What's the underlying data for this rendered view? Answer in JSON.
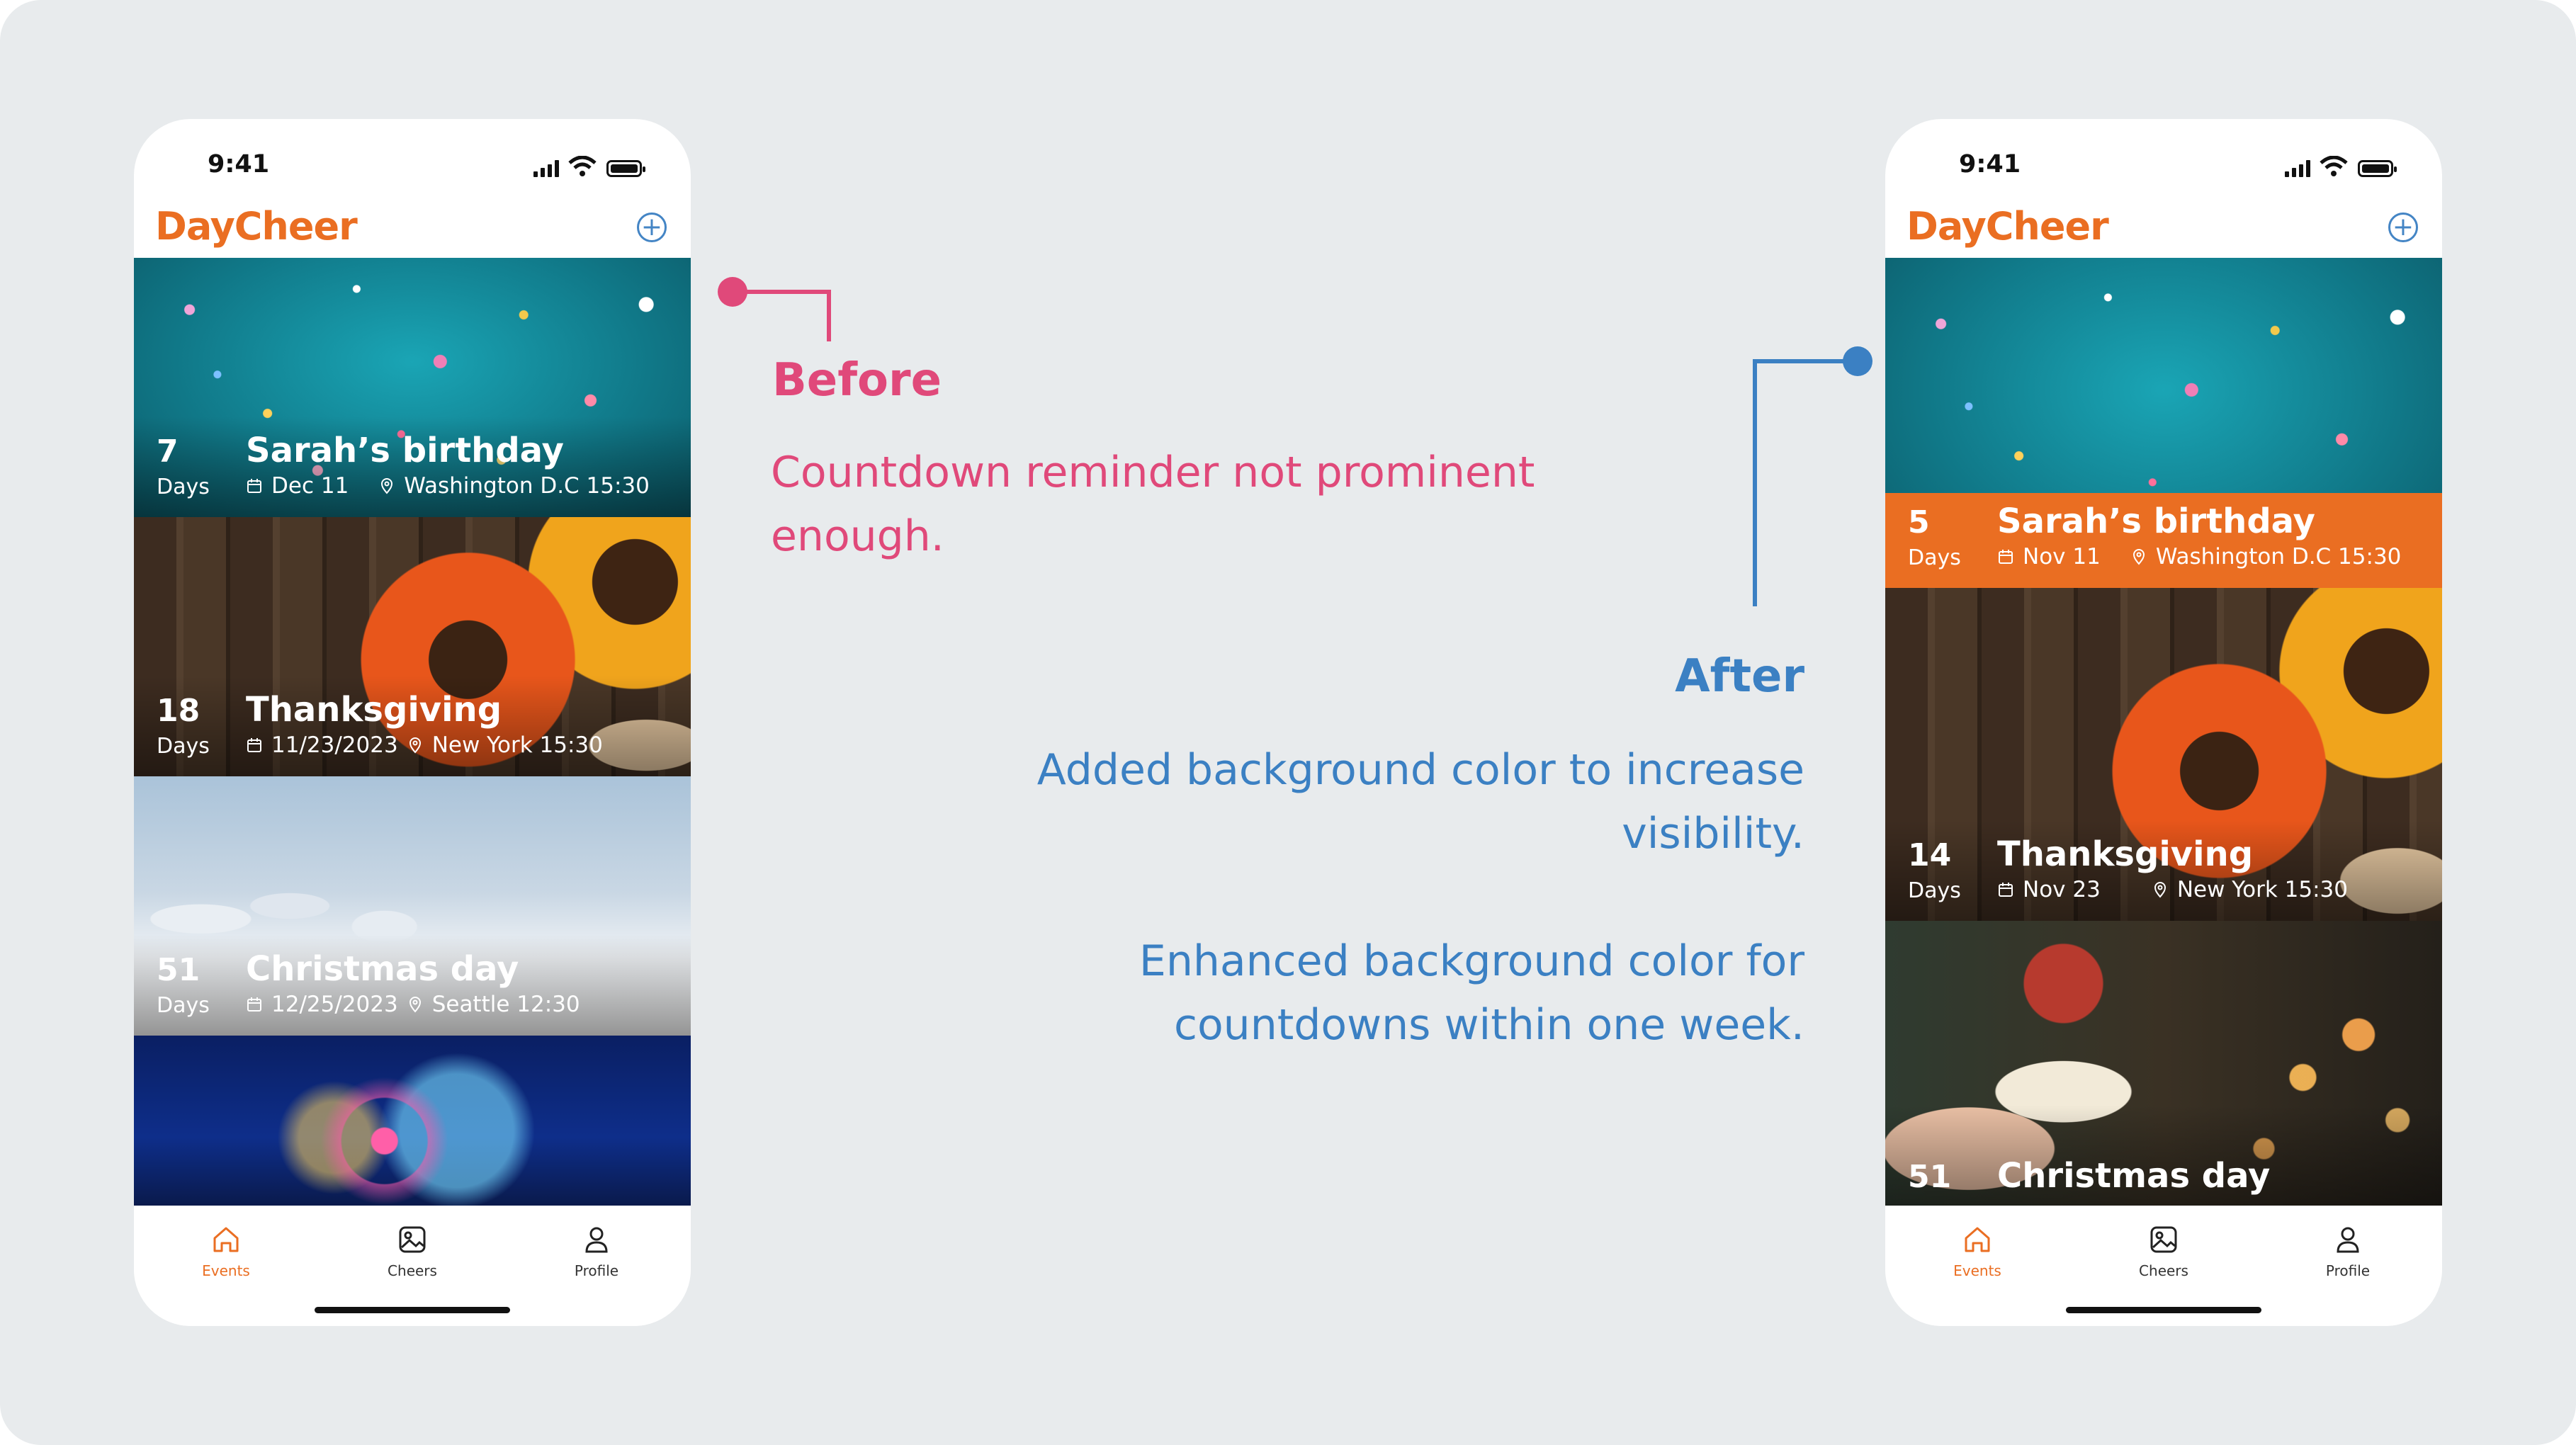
{
  "status_time": "9:41",
  "app_name": "DayCheer",
  "tabs": [
    {
      "label": "Events",
      "icon": "home-icon",
      "active": true
    },
    {
      "label": "Cheers",
      "icon": "image-icon",
      "active": false
    },
    {
      "label": "Profile",
      "icon": "user-icon",
      "active": false
    }
  ],
  "before": {
    "events": [
      {
        "count": "7",
        "unit": "Days",
        "title": "Sarah’s birthday",
        "date": "Dec 11",
        "location": "Washington D.C 15:30"
      },
      {
        "count": "18",
        "unit": "Days",
        "title": "Thanksgiving",
        "date": "11/23/2023",
        "location": "New York 15:30"
      },
      {
        "count": "51",
        "unit": "Days",
        "title": "Christmas day",
        "date": "12/25/2023",
        "location": "Seattle 12:30"
      }
    ]
  },
  "after": {
    "events": [
      {
        "count": "5",
        "unit": "Days",
        "title": "Sarah’s birthday",
        "date": "Nov 11",
        "location": "Washington D.C 15:30"
      },
      {
        "count": "14",
        "unit": "Days",
        "title": "Thanksgiving",
        "date": "Nov 23",
        "location": "New York 15:30"
      },
      {
        "count": "51",
        "title": "Christmas day"
      }
    ]
  },
  "annotations": {
    "before_title": "Before",
    "before_text_1": "Countdown reminder not prominent",
    "before_text_2": "enough.",
    "after_title": "After",
    "after_text_1a": "Added background color to increase",
    "after_text_1b": "visibility.",
    "after_text_2a": "Enhanced background color for",
    "after_text_2b": "countdowns within one week."
  },
  "colors": {
    "brand_orange": "#ea6e22",
    "before_accent": "#e0497a",
    "after_accent": "#3b80c3",
    "background": "#e8ebed"
  }
}
